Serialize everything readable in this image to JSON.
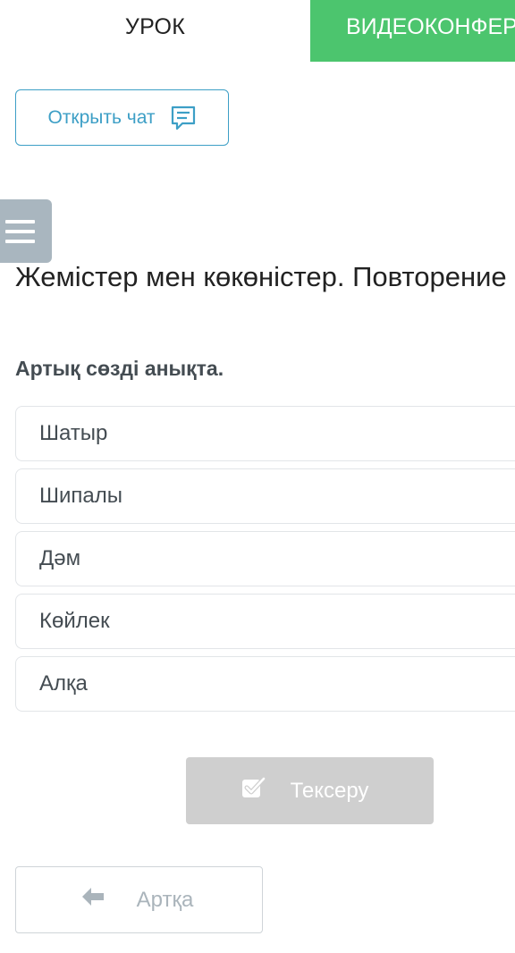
{
  "tabs": {
    "lesson": "УРОК",
    "video": "ВИДЕОКОНФЕРЕНЦИЯ"
  },
  "chat": {
    "label": "Открыть чат",
    "icon": "chat-bubble-icon"
  },
  "menu": {
    "icon": "hamburger-menu-icon"
  },
  "lesson": {
    "title": "Жемістер мен көкөністер. Повторение"
  },
  "question": {
    "text": "Артық сөзді анықта.",
    "options": [
      "Шатыр",
      "Шипалы",
      "Дәм",
      "Көйлек",
      "Алқа"
    ]
  },
  "actions": {
    "check_label": "Тексеру",
    "check_icon": "checkbox-check-icon",
    "back_label": "Артқа",
    "back_icon": "arrow-left-icon"
  },
  "colors": {
    "accent_green": "#4cc56e",
    "accent_blue": "#3d9fc6",
    "menu_gray": "#a9b6bf",
    "disabled_gray": "#cfcfcf"
  }
}
